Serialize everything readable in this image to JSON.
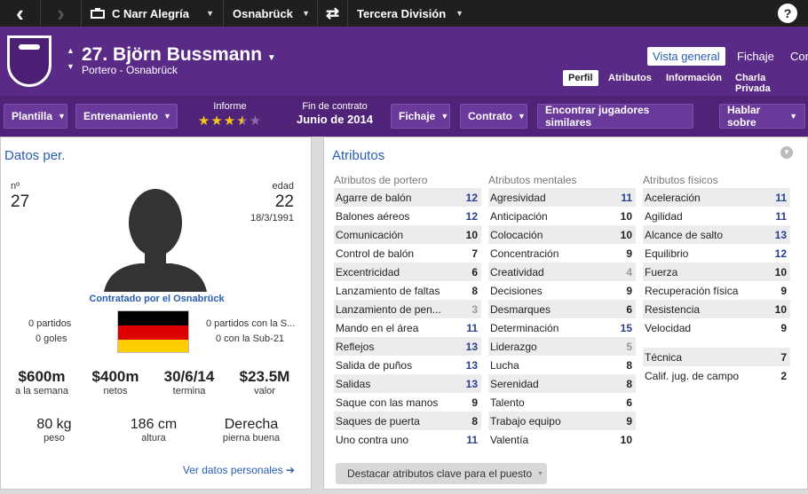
{
  "topbar": {
    "nav_back": "‹",
    "nav_forward": "›",
    "manager": "C Narr Alegría",
    "club": "Osnabrück",
    "competition": "Tercera División",
    "help": "?"
  },
  "header": {
    "player_name": "27. Björn Bussmann",
    "subtitle": "Portero - Osnabrück",
    "main_tabs": [
      "Vista general",
      "Fichaje",
      "Con"
    ],
    "sub_tabs": [
      "Perfil",
      "Atributos",
      "Información",
      "Charla Privada"
    ]
  },
  "actions": {
    "plantilla": "Plantilla",
    "entrenamiento": "Entrenamiento",
    "informe_label": "Informe",
    "informe_stars": 3.5,
    "contract_label": "Fin de contrato",
    "contract_value": "Junio de 2014",
    "fichaje": "Fichaje",
    "contrato": "Contrato",
    "similares": "Encontrar jugadores similares",
    "hablar": "Hablar sobre"
  },
  "personal": {
    "title": "Datos per.",
    "number_label": "nº",
    "number": "27",
    "age_label": "edad",
    "age": "22",
    "dob": "18/3/1991",
    "contracted": "Contratado por el Osnabrück",
    "partidos": "0 partidos",
    "goles": "0 goles",
    "partidos_sub": "0 partidos con la S...",
    "sub21": "0 con la Sub-21",
    "stats": [
      {
        "value": "$600m",
        "label": "a la semana"
      },
      {
        "value": "$400m",
        "label": "netos"
      },
      {
        "value": "30/6/14",
        "label": "termina"
      },
      {
        "value": "$23.5M",
        "label": "valor"
      }
    ],
    "physical": [
      {
        "value": "80 kg",
        "label": "peso"
      },
      {
        "value": "186 cm",
        "label": "altura"
      },
      {
        "value": "Derecha",
        "label": "pierna buena"
      }
    ],
    "more_link": "Ver datos personales ➔",
    "flag_colors": [
      "#000000",
      "#dd0000",
      "#ffce00"
    ]
  },
  "attributes": {
    "title": "Atributos",
    "goalkeeper_title": "Atributos de portero",
    "mental_title": "Atributos mentales",
    "physical_title": "Atributos físicos",
    "goalkeeper": [
      {
        "name": "Agarre de balón",
        "value": "12",
        "hl": true
      },
      {
        "name": "Balones aéreos",
        "value": "12",
        "hl": true
      },
      {
        "name": "Comunicación",
        "value": "10"
      },
      {
        "name": "Control de balón",
        "value": "7"
      },
      {
        "name": "Excentricidad",
        "value": "6"
      },
      {
        "name": "Lanzamiento de faltas",
        "value": "8"
      },
      {
        "name": "Lanzamiento de pen...",
        "value": "3",
        "dim": true
      },
      {
        "name": "Mando en el área",
        "value": "11",
        "hl": true
      },
      {
        "name": "Reflejos",
        "value": "13",
        "hl": true
      },
      {
        "name": "Salida de puños",
        "value": "13",
        "hl": true
      },
      {
        "name": "Salidas",
        "value": "13",
        "hl": true
      },
      {
        "name": "Saque con las manos",
        "value": "9"
      },
      {
        "name": "Saques de puerta",
        "value": "8"
      },
      {
        "name": "Uno contra uno",
        "value": "11",
        "hl": true
      }
    ],
    "mental": [
      {
        "name": "Agresividad",
        "value": "11",
        "hl": true
      },
      {
        "name": "Anticipación",
        "value": "10"
      },
      {
        "name": "Colocación",
        "value": "10"
      },
      {
        "name": "Concentración",
        "value": "9"
      },
      {
        "name": "Creatividad",
        "value": "4",
        "dim": true
      },
      {
        "name": "Decisiones",
        "value": "9"
      },
      {
        "name": "Desmarques",
        "value": "6"
      },
      {
        "name": "Determinación",
        "value": "15",
        "hl": true
      },
      {
        "name": "Liderazgo",
        "value": "5",
        "dim": true
      },
      {
        "name": "Lucha",
        "value": "8"
      },
      {
        "name": "Serenidad",
        "value": "8"
      },
      {
        "name": "Talento",
        "value": "6"
      },
      {
        "name": "Trabajo equipo",
        "value": "9"
      },
      {
        "name": "Valentía",
        "value": "10"
      }
    ],
    "physical": [
      {
        "name": "Aceleración",
        "value": "11",
        "hl": true
      },
      {
        "name": "Agilidad",
        "value": "11",
        "hl": true
      },
      {
        "name": "Alcance de salto",
        "value": "13",
        "hl": true
      },
      {
        "name": "Equilibrio",
        "value": "12",
        "hl": true
      },
      {
        "name": "Fuerza",
        "value": "10"
      },
      {
        "name": "Recuperación física",
        "value": "9"
      },
      {
        "name": "Resistencia",
        "value": "10"
      },
      {
        "name": "Velocidad",
        "value": "9"
      }
    ],
    "extra": [
      {
        "name": "Técnica",
        "value": "7"
      },
      {
        "name": "Calif. jug. de campo",
        "value": "2"
      }
    ],
    "highlight_button": "Destacar atributos clave para el puesto"
  }
}
